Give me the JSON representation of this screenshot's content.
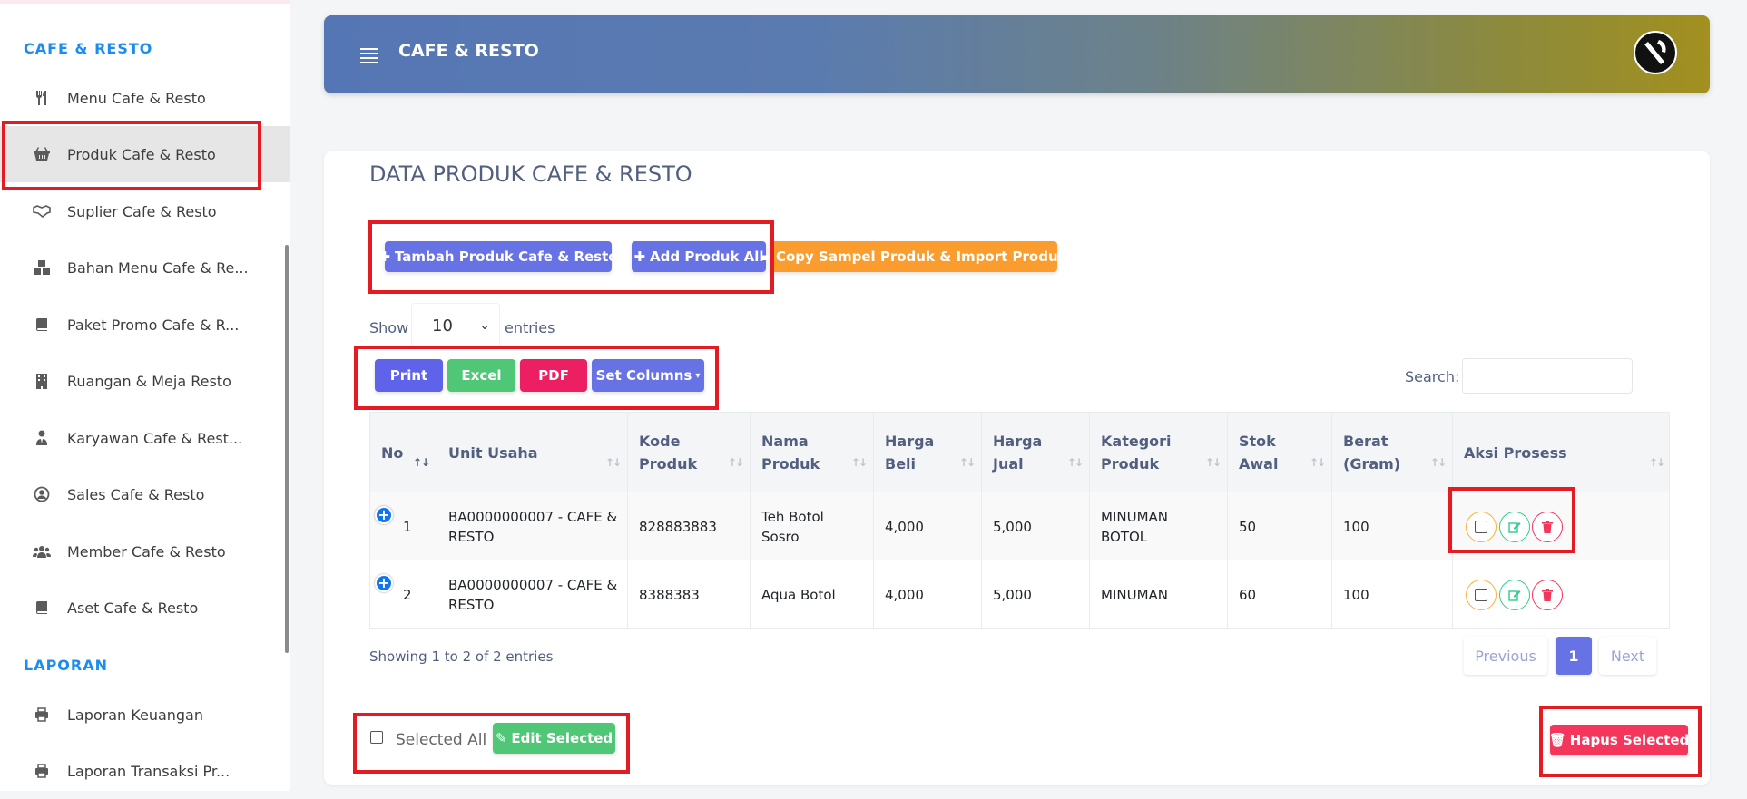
{
  "sidebar": {
    "section_cafe": "CAFE & RESTO",
    "items": [
      {
        "label": "Menu Cafe & Resto",
        "icon": "utensils-icon"
      },
      {
        "label": "Produk Cafe & Resto",
        "icon": "basket-icon",
        "active": true
      },
      {
        "label": "Suplier Cafe & Resto",
        "icon": "handshake-icon"
      },
      {
        "label": "Bahan Menu Cafe & Re...",
        "icon": "cubes-icon"
      },
      {
        "label": "Paket Promo Cafe & R...",
        "icon": "book-icon"
      },
      {
        "label": "Ruangan & Meja Resto",
        "icon": "building-icon"
      },
      {
        "label": "Karyawan Cafe & Rest...",
        "icon": "user-tie-icon"
      },
      {
        "label": "Sales Cafe & Resto",
        "icon": "user-circle-icon"
      },
      {
        "label": "Member Cafe & Resto",
        "icon": "users-icon"
      },
      {
        "label": "Aset Cafe & Resto",
        "icon": "book-icon"
      }
    ],
    "section_laporan": "LAPORAN",
    "laporan_items": [
      {
        "label": "Laporan Keuangan",
        "icon": "printer-icon"
      },
      {
        "label": "Laporan Transaksi Pr...",
        "icon": "printer-icon"
      }
    ]
  },
  "header": {
    "title": "CAFE & RESTO"
  },
  "card": {
    "title": "DATA PRODUK CAFE & RESTO",
    "buttons": {
      "tambah": "Tambah Produk Cafe & Resto",
      "add_all": "Add Produk All",
      "copy": "Copy Sampel Produk & Import Produk"
    },
    "show_label": "Show",
    "entries_value": "10",
    "entries_label": "entries",
    "export": {
      "print": "Print",
      "excel": "Excel",
      "pdf": "PDF",
      "set_columns": "Set Columns"
    },
    "search_label": "Search:",
    "search_value": ""
  },
  "table": {
    "columns": [
      "No",
      "Unit Usaha",
      "Kode Produk",
      "Nama Produk",
      "Harga Beli",
      "Harga Jual",
      "Kategori Produk",
      "Stok Awal",
      "Berat (Gram)",
      "Aksi Prosess"
    ],
    "rows": [
      {
        "no": "1",
        "unit_usaha": "BA0000000007 - CAFE & RESTO",
        "kode": "828883883",
        "nama": "Teh Botol Sosro",
        "beli": "4,000",
        "jual": "5,000",
        "kategori": "MINUMAN BOTOL",
        "stok": "50",
        "berat": "100"
      },
      {
        "no": "2",
        "unit_usaha": "BA0000000007 - CAFE & RESTO",
        "kode": "8388383",
        "nama": "Aqua Botol",
        "beli": "4,000",
        "jual": "5,000",
        "kategori": "MINUMAN",
        "stok": "60",
        "berat": "100"
      }
    ]
  },
  "footer": {
    "info": "Showing 1 to 2 of 2 entries",
    "previous": "Previous",
    "page": "1",
    "next": "Next",
    "selected_all": "Selected All",
    "edit_selected": "Edit Selected",
    "hapus_selected": "Hapus Selected"
  },
  "colors": {
    "accent_blue": "#1b8cf0",
    "indigo": "#6772e5",
    "orange": "#fb9d2e",
    "green": "#4fc776",
    "pink": "#ec1f62",
    "red": "#f5365c",
    "highlight_box": "#e41b23"
  }
}
